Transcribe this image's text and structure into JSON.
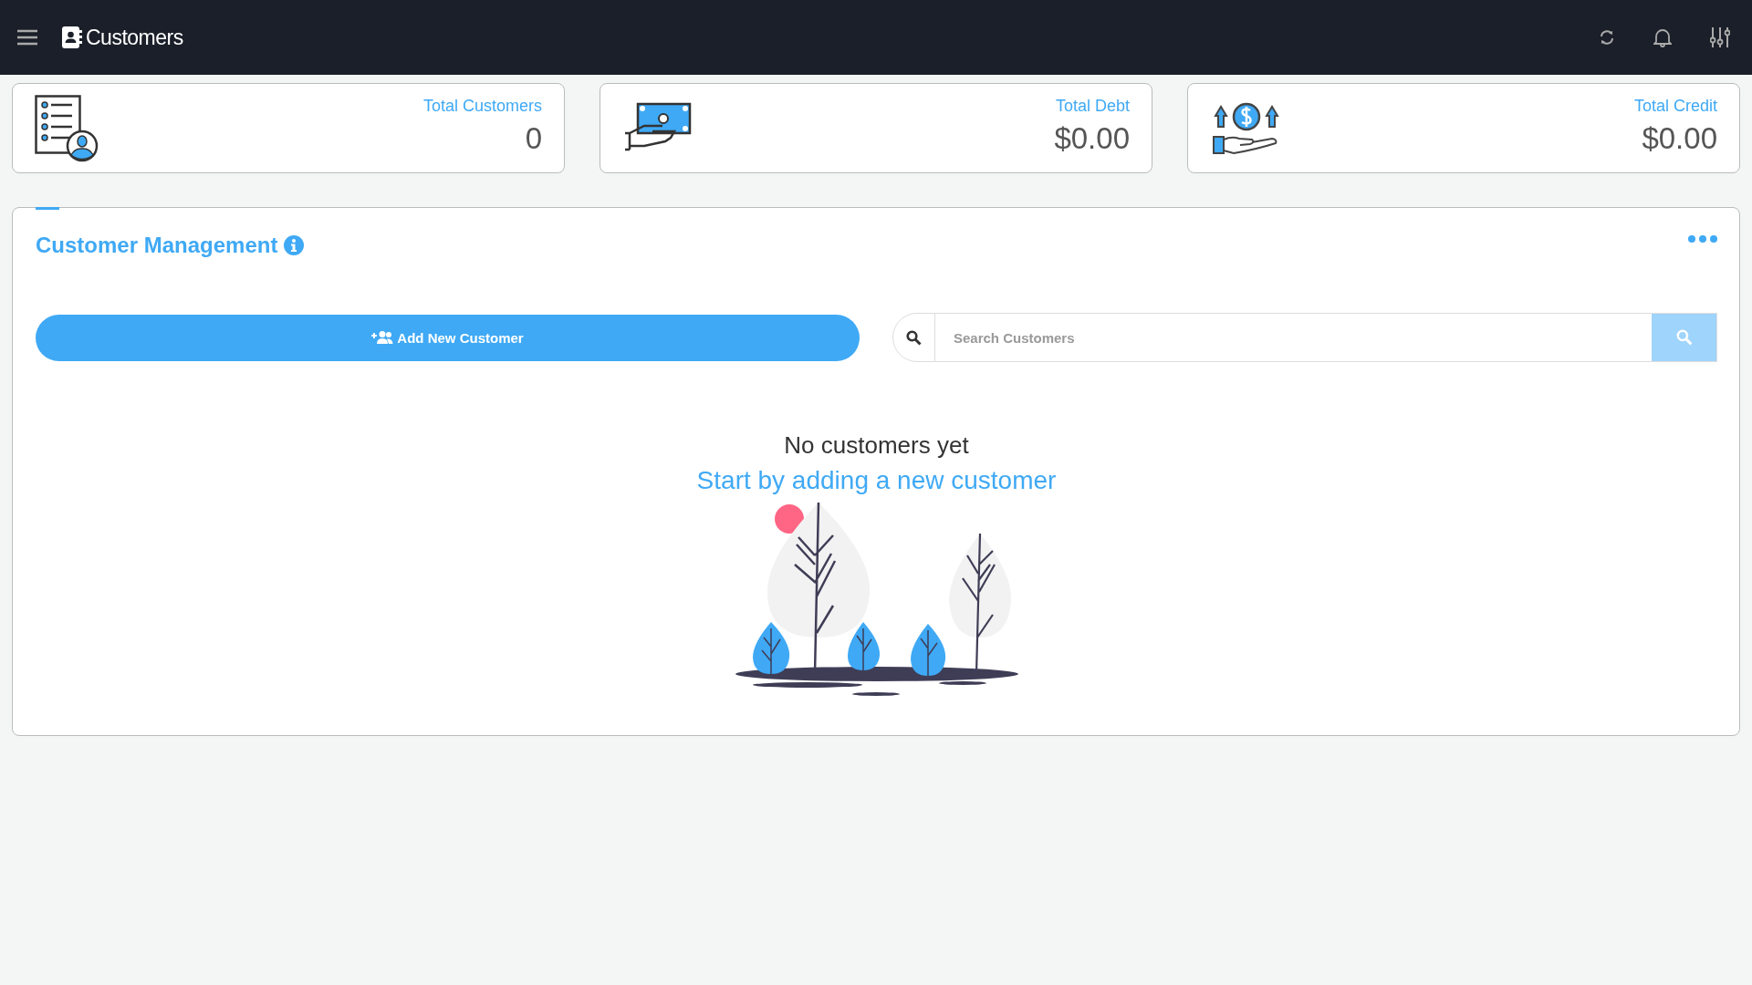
{
  "topbar": {
    "title": "Customers"
  },
  "stats": [
    {
      "kind": "customers",
      "label": "Total Customers",
      "value": "0"
    },
    {
      "kind": "debt",
      "label": "Total Debt",
      "value": "$0.00"
    },
    {
      "kind": "credit",
      "label": "Total Credit",
      "value": "$0.00"
    }
  ],
  "panel": {
    "title": "Customer Management",
    "add_button": "Add New Customer",
    "search": {
      "placeholder": "Search Customers"
    },
    "empty_title": "No customers yet",
    "empty_subtitle": "Start by adding a new customer"
  }
}
